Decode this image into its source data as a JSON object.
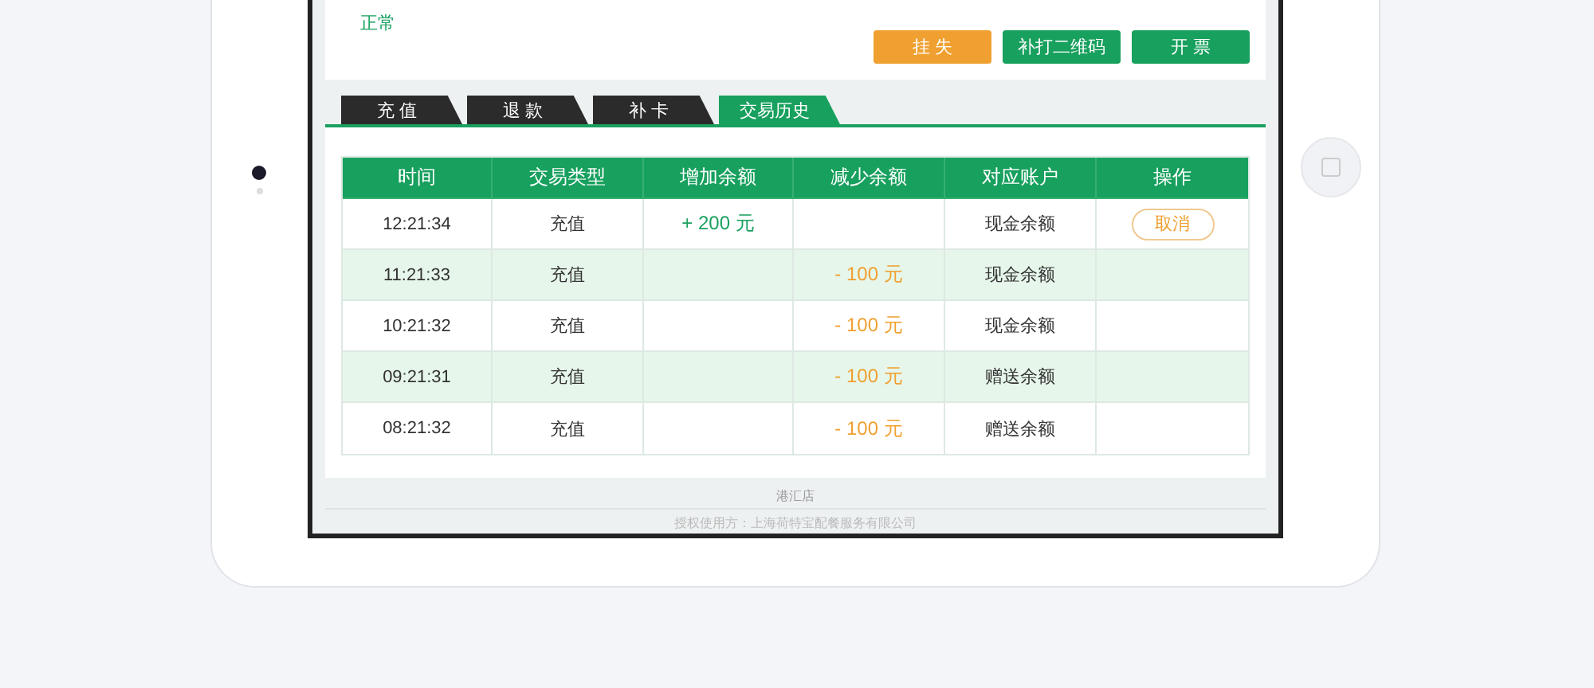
{
  "card_status": "正常",
  "actions": [
    {
      "label": "挂 失",
      "kind": "warning"
    },
    {
      "label": "补打二维码",
      "kind": "primary"
    },
    {
      "label": "开 票",
      "kind": "primary"
    }
  ],
  "tabs": [
    {
      "label": "充 值",
      "selected": false
    },
    {
      "label": "退 款",
      "selected": false
    },
    {
      "label": "补 卡",
      "selected": false
    },
    {
      "label": "交易历史",
      "selected": true
    }
  ],
  "table": {
    "columns": [
      "时间",
      "交易类型",
      "增加余额",
      "减少余额",
      "对应账户",
      "操作"
    ],
    "rows": [
      {
        "time": "12:21:34",
        "type": "充值",
        "increase": "+ 200 元",
        "decrease": "",
        "account": "现金余额",
        "action": "取消",
        "selected": false
      },
      {
        "time": "11:21:33",
        "type": "充值",
        "increase": "",
        "decrease": "- 100 元",
        "account": "现金余额",
        "selected": true
      },
      {
        "time": "10:21:32",
        "type": "充值",
        "increase": "",
        "decrease": "- 100 元",
        "account": "现金余额",
        "selected": false
      },
      {
        "time": "09:21:31",
        "type": "充值",
        "increase": "",
        "decrease": "- 100 元",
        "account": "赠送余额",
        "selected": true
      },
      {
        "time": "08:21:32",
        "type": "充值",
        "increase": "",
        "decrease": "- 100 元",
        "account": "赠送余额",
        "selected": false
      }
    ]
  },
  "footer": {
    "store": "港汇店",
    "license": "授权使用方：上海荷特宝配餐服务有限公司"
  }
}
